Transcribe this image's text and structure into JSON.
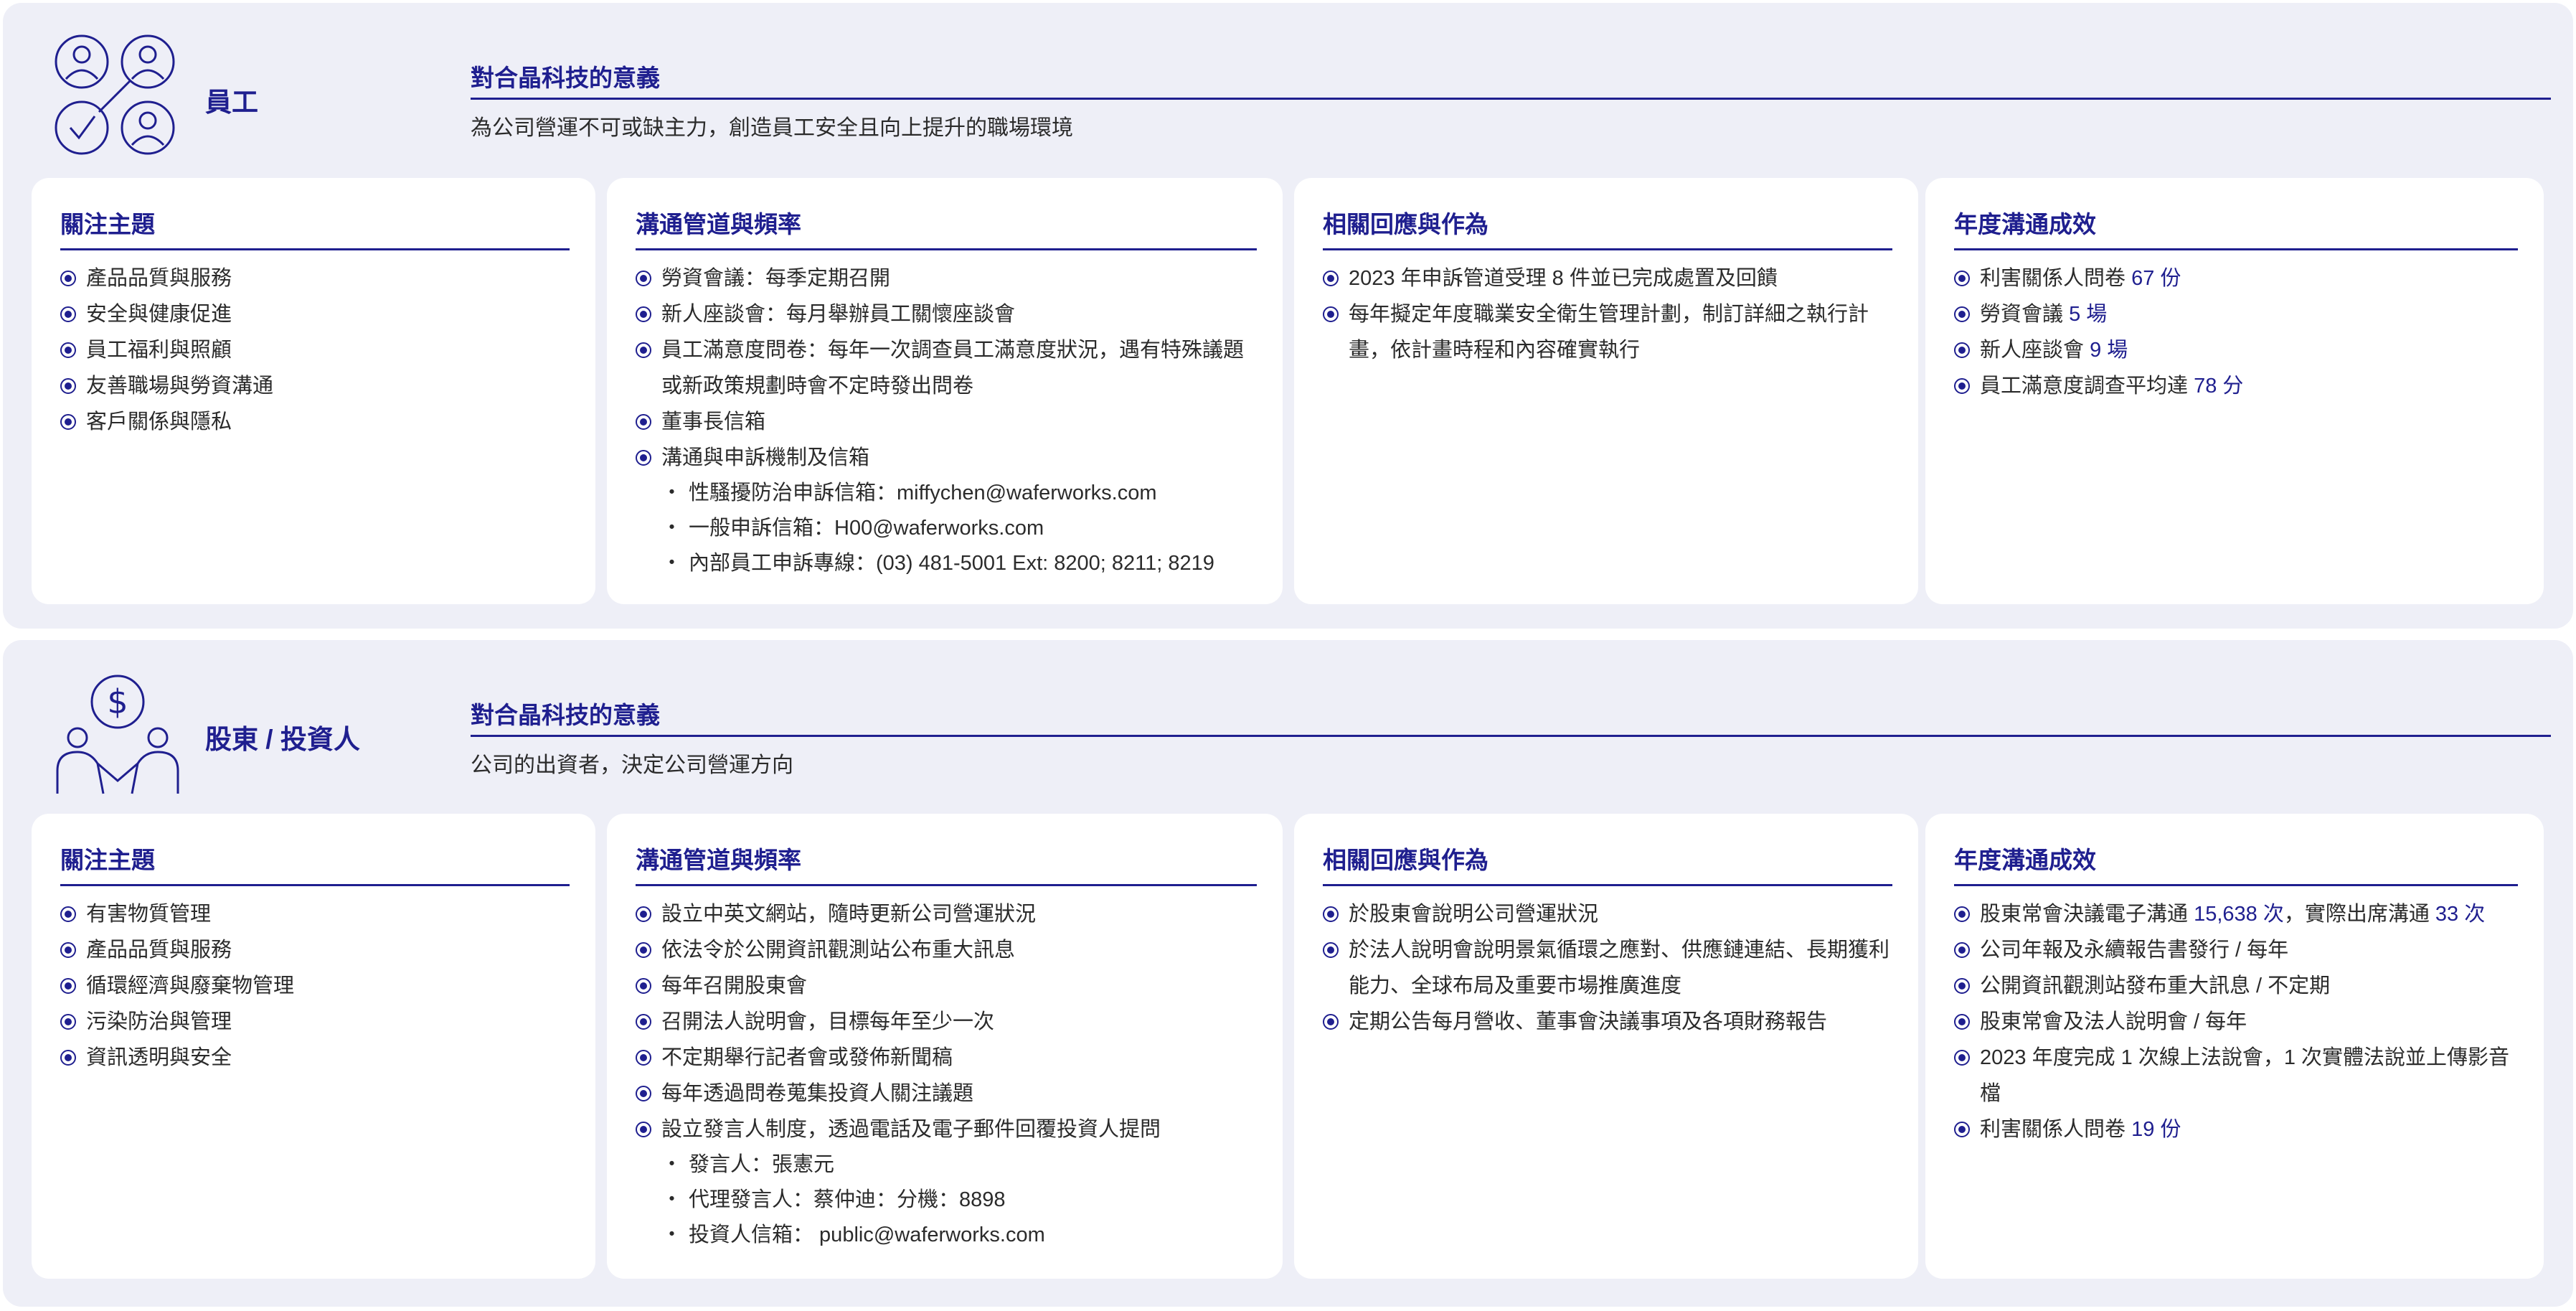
{
  "sections": [
    {
      "name": "員工",
      "icon": "employees-icon",
      "meaning_title": "對合晶科技的意義",
      "meaning_text": "為公司營運不可或缺主力，創造員工安全且向上提升的職場環境",
      "topics": {
        "title": "關注主題",
        "items": [
          "產品品質與服務",
          "安全與健康促進",
          "員工福利與照顧",
          "友善職場與勞資溝通",
          "客戶關係與隱私"
        ]
      },
      "channels": {
        "title": "溝通管道與頻率",
        "items": [
          "勞資會議：每季定期召開",
          "新人座談會：每月舉辦員工關懷座談會",
          "員工滿意度問卷：每年一次調查員工滿意度狀況，遇有特殊議題或新政策規劃時會不定時發出問卷",
          "董事長信箱",
          "溝通與申訴機制及信箱"
        ],
        "sub_items": [
          "性騷擾防治申訴信箱：miffychen@waferworks.com",
          "一般申訴信箱：H00@waferworks.com",
          "內部員工申訴專線：(03) 481-5001 Ext: 8200; 8211; 8219"
        ]
      },
      "responses": {
        "title": "相關回應與作為",
        "items": [
          "2023 年申訴管道受理 8 件並已完成處置及回饋",
          "每年擬定年度職業安全衛生管理計劃，制訂詳細之執行計畫，依計畫時程和內容確實執行"
        ]
      },
      "results": {
        "title": "年度溝通成效",
        "items": [
          {
            "text": "利害關係人問卷 ",
            "value": "67 份"
          },
          {
            "text": "勞資會議 ",
            "value": "5 場"
          },
          {
            "text": "新人座談會 ",
            "value": "9 場"
          },
          {
            "text": "員工滿意度調查平均達 ",
            "value": "78 分"
          }
        ]
      }
    },
    {
      "name": "股東 / 投資人",
      "icon": "investor-icon",
      "meaning_title": "對合晶科技的意義",
      "meaning_text": "公司的出資者，決定公司營運方向",
      "topics": {
        "title": "關注主題",
        "items": [
          "有害物質管理",
          "產品品質與服務",
          "循環經濟與廢棄物管理",
          "污染防治與管理",
          "資訊透明與安全"
        ]
      },
      "channels": {
        "title": "溝通管道與頻率",
        "items": [
          "設立中英文網站，隨時更新公司營運狀況",
          "依法令於公開資訊觀測站公布重大訊息",
          "每年召開股東會",
          "召開法人說明會，目標每年至少一次",
          "不定期舉行記者會或發佈新聞稿",
          "每年透過問卷蒐集投資人關注議題",
          "設立發言人制度，透過電話及電子郵件回覆投資人提問"
        ],
        "sub_items": [
          "發言人：張憲元",
          "代理發言人：蔡仲迪：分機：8898",
          "投資人信箱： public@waferworks.com"
        ]
      },
      "responses": {
        "title": "相關回應與作為",
        "items": [
          "於股東會說明公司營運狀況",
          "於法人說明會說明景氣循環之應對、供應鏈連結、長期獲利能力、全球布局及重要市場推廣進度",
          "定期公告每月營收、董事會決議事項及各項財務報告"
        ]
      },
      "results": {
        "title": "年度溝通成效",
        "items": [
          {
            "text": "股東常會決議電子溝通 ",
            "value": "15,638 次",
            "text2": "，實際出席溝通 ",
            "value2": "33 次"
          },
          {
            "text": "公司年報及永續報告書發行 / 每年"
          },
          {
            "text": "公開資訊觀測站發布重大訊息 / 不定期"
          },
          {
            "text": "股東常會及法人說明會 / 每年"
          },
          {
            "text": "2023 年度完成 1 次線上法說會，1 次實體法說並上傳影音檔"
          },
          {
            "text": "利害關係人問卷 ",
            "value": "19 份"
          }
        ]
      }
    }
  ]
}
